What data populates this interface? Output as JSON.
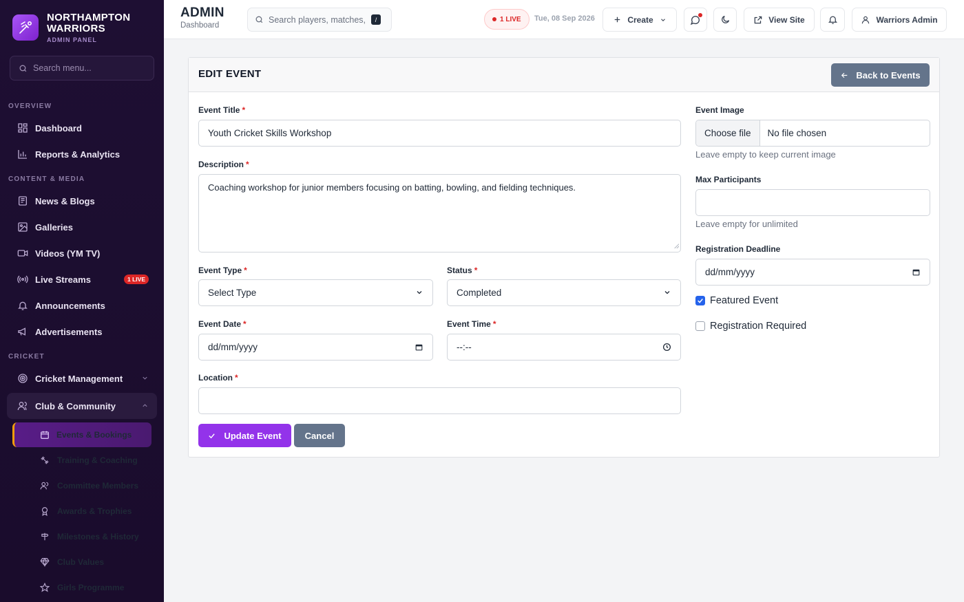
{
  "brand": {
    "name": "NORTHAMPTON WARRIORS",
    "subtitle": "ADMIN PANEL"
  },
  "sidebar": {
    "search_placeholder": "Search menu...",
    "sections": {
      "overview": "OVERVIEW",
      "content": "CONTENT & MEDIA",
      "cricket": "CRICKET"
    },
    "items": {
      "dashboard": "Dashboard",
      "reports": "Reports & Analytics",
      "news": "News & Blogs",
      "galleries": "Galleries",
      "videos": "Videos (YM TV)",
      "live_streams": "Live Streams",
      "live_badge": "1 LIVE",
      "announcements": "Announcements",
      "advertisements": "Advertisements",
      "cricket_management": "Cricket Management",
      "club_community": "Club & Community"
    },
    "sub_items": {
      "events": "Events & Bookings",
      "training": "Training & Coaching",
      "committee": "Committee Members",
      "awards": "Awards & Trophies",
      "milestones": "Milestones & History",
      "values": "Club Values",
      "girls": "Girls Programme"
    }
  },
  "topbar": {
    "title": "ADMIN",
    "breadcrumb": "Dashboard",
    "search_placeholder": "Search players, matches, r",
    "search_shortcut": "/",
    "live_label": "1 LIVE",
    "date": "Tue, 08 Sep 2026",
    "create_label": "Create",
    "view_site_label": "View Site",
    "user_label": "Warriors Admin"
  },
  "form": {
    "heading": "EDIT EVENT",
    "back_label": "Back to Events",
    "title_label": "Event Title",
    "title_value": "Youth Cricket Skills Workshop",
    "description_label": "Description",
    "description_value": "Coaching workshop for junior members focusing on batting, bowling, and fielding techniques.",
    "type_label": "Event Type",
    "type_value": "Select Type",
    "status_label": "Status",
    "status_value": "Completed",
    "date_label": "Event Date",
    "date_placeholder": "dd/mm/yyyy",
    "time_label": "Event Time",
    "time_placeholder": "--:--",
    "location_label": "Location",
    "location_value": "",
    "image_label": "Event Image",
    "choose_file": "Choose file",
    "no_file": "No file chosen",
    "image_help": "Leave empty to keep current image",
    "max_label": "Max Participants",
    "max_value": "",
    "max_help": "Leave empty for unlimited",
    "deadline_label": "Registration Deadline",
    "deadline_placeholder": "dd/mm/yyyy",
    "featured_label": "Featured Event",
    "featured_checked": true,
    "registration_label": "Registration Required",
    "registration_checked": false,
    "required_mark": "*",
    "submit_label": "Update Event",
    "cancel_label": "Cancel"
  },
  "colors": {
    "sidebar_bg": "#1e0f33",
    "accent": "#9333ea",
    "live": "#dc2626",
    "secondary_button": "#64748b",
    "checkbox": "#2563eb"
  }
}
